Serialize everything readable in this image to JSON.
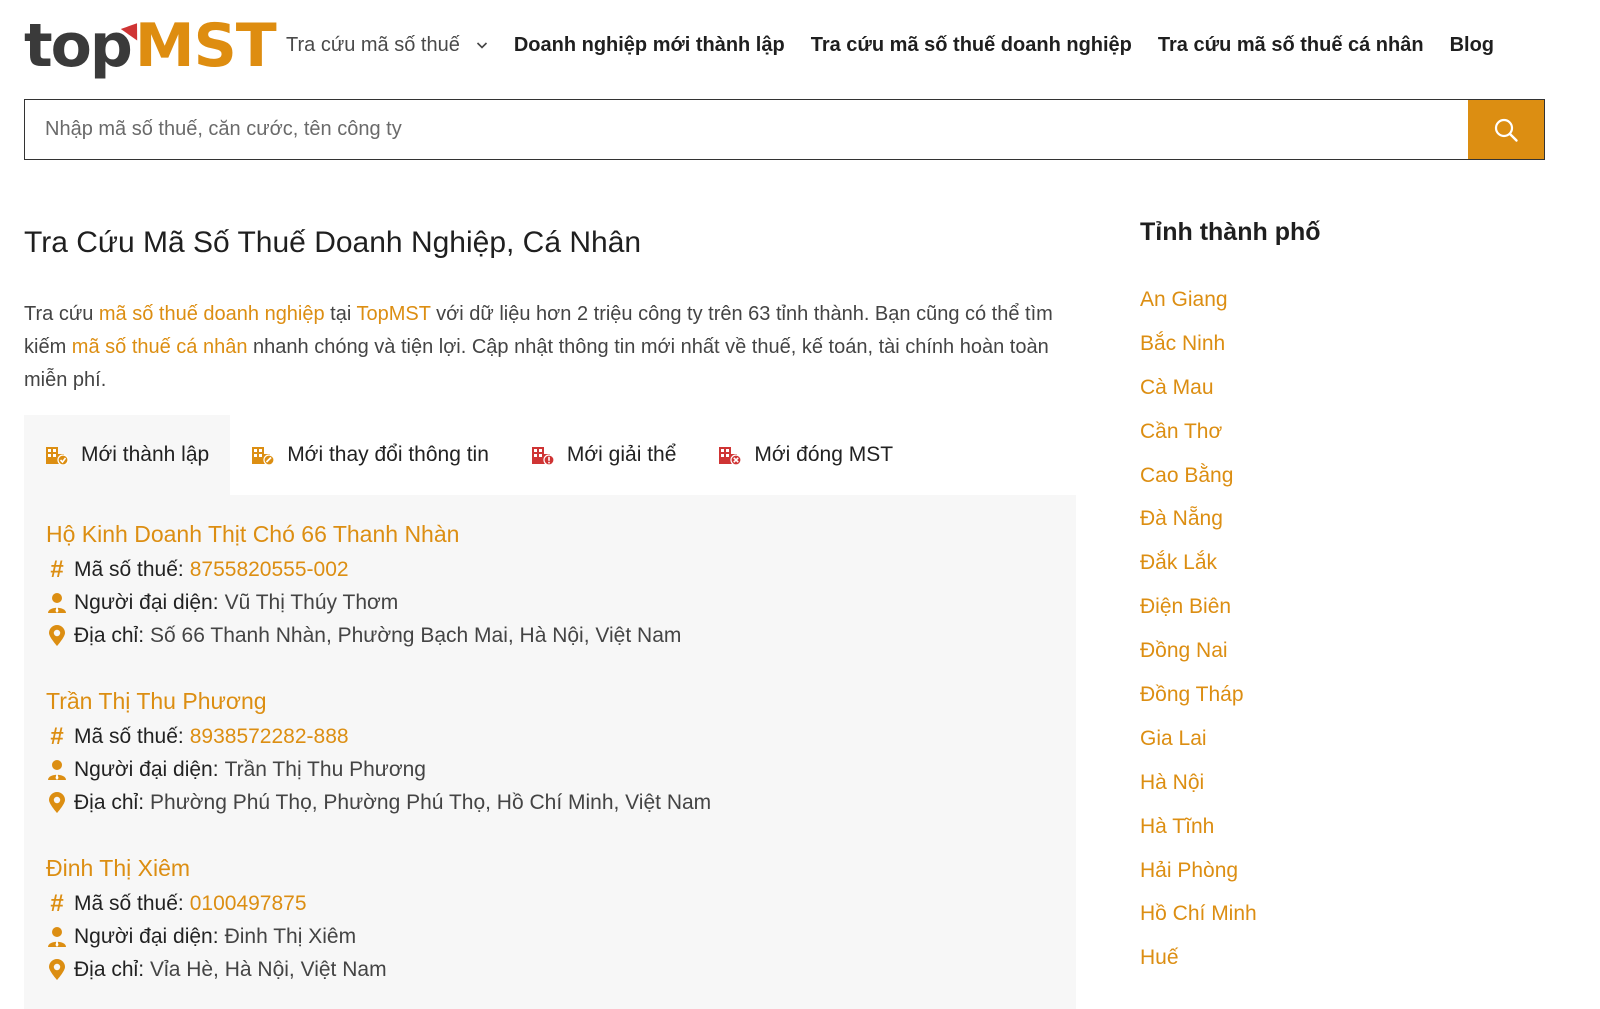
{
  "logo": {
    "part1": "top",
    "part2": "MST"
  },
  "nav": {
    "items": [
      {
        "label": "Tra cứu mã số thuế",
        "has_dropdown": true
      },
      {
        "label": "Doanh nghiệp mới thành lập"
      },
      {
        "label": "Tra cứu mã số thuế doanh nghiệp"
      },
      {
        "label": "Tra cứu mã số thuế cá nhân"
      },
      {
        "label": "Blog"
      }
    ]
  },
  "search": {
    "placeholder": "Nhập mã số thuế, căn cước, tên công ty",
    "value": ""
  },
  "main": {
    "title": "Tra Cứu Mã Số Thuế Doanh Nghiệp, Cá Nhân",
    "intro": {
      "t1": "Tra cứu ",
      "link1": "mã số thuế doanh nghiệp",
      "t2": " tại ",
      "link2": "TopMST",
      "t3": " với dữ liệu hơn 2 triệu công ty trên 63 tỉnh thành. Bạn cũng có thể tìm kiếm ",
      "link3": "mã số thuế cá nhân",
      "t4": " nhanh chóng và tiện lợi. Cập nhật thông tin mới nhất về thuế, kế toán, tài chính hoàn toàn miễn phí."
    },
    "tabs": [
      {
        "label": "Mới thành lập",
        "active": true
      },
      {
        "label": "Mới thay đổi thông tin",
        "active": false
      },
      {
        "label": "Mới giải thể",
        "active": false
      },
      {
        "label": "Mới đóng MST",
        "active": false
      }
    ],
    "labels": {
      "tax": "Mã số thuế:",
      "rep": "Người đại diện:",
      "addr": "Địa chỉ:"
    },
    "companies": [
      {
        "name": "Hộ Kinh Doanh Thịt Chó 66 Thanh Nhàn",
        "tax_id": "8755820555-002",
        "representative": "Vũ Thị Thúy Thơm",
        "address": "Số 66 Thanh Nhàn, Phường Bạch Mai, Hà Nội, Việt Nam"
      },
      {
        "name": "Trần Thị Thu Phương",
        "tax_id": "8938572282-888",
        "representative": "Trần Thị Thu Phương",
        "address": "Phường Phú Thọ, Phường Phú Thọ, Hồ Chí Minh, Việt Nam"
      },
      {
        "name": "Đinh Thị Xiêm",
        "tax_id": "0100497875",
        "representative": "Đinh Thị Xiêm",
        "address": "Vỉa Hè, Hà Nội, Việt Nam"
      }
    ]
  },
  "sidebar": {
    "title": "Tỉnh thành phố",
    "provinces": [
      "An Giang",
      "Bắc Ninh",
      "Cà Mau",
      "Cần Thơ",
      "Cao Bằng",
      "Đà Nẵng",
      "Đắk Lắk",
      "Điện Biên",
      "Đồng Nai",
      "Đồng Tháp",
      "Gia Lai",
      "Hà Nội",
      "Hà Tĩnh",
      "Hải Phòng",
      "Hồ Chí Minh",
      "Huế"
    ]
  },
  "colors": {
    "accent": "#dc8e12",
    "danger": "#cf3434",
    "text": "#222222",
    "panel": "#f7f7f7"
  },
  "icons": {
    "search": "search-icon",
    "tax": "hash-icon",
    "rep": "person-icon",
    "addr": "map-pin-icon"
  }
}
